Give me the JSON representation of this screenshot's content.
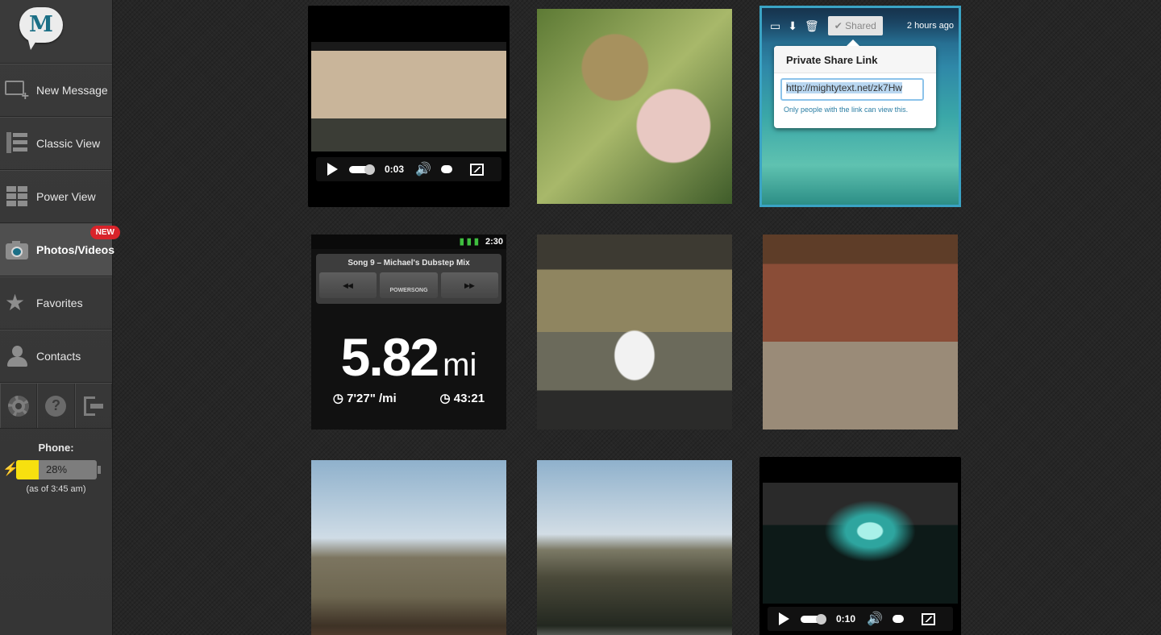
{
  "sidebar": {
    "logo_letter": "M",
    "items": [
      {
        "label": "New Message",
        "icon": "new-message-icon"
      },
      {
        "label": "Classic View",
        "icon": "classic-view-icon"
      },
      {
        "label": "Power View",
        "icon": "power-view-icon"
      },
      {
        "label": "Photos/Videos",
        "icon": "camera-icon",
        "active": true,
        "badge": "NEW"
      },
      {
        "label": "Favorites",
        "icon": "star-icon"
      },
      {
        "label": "Contacts",
        "icon": "contact-icon"
      }
    ],
    "tools": [
      {
        "icon": "settings-gear-icon"
      },
      {
        "icon": "help-icon",
        "glyph": "?"
      },
      {
        "icon": "logout-icon"
      }
    ],
    "phone": {
      "label": "Phone:",
      "battery_percent": 28,
      "battery_text": "28%",
      "as_of": "(as of 3:45 am)"
    },
    "accent_color": "#d8232a"
  },
  "gallery": {
    "videos": [
      {
        "time": "0:03"
      },
      {
        "time": "0:10"
      }
    ],
    "share": {
      "shared_label": "Shared",
      "check": "✔",
      "time_ago": "2 hours ago",
      "title": "Private Share Link",
      "link": "http://mightytext.net/zk7Hw",
      "note": "Only people with the link can view this.",
      "highlight_color": "#3aa3c4"
    },
    "run_screen": {
      "clock": "2:30",
      "song": "Song 9 – Michael's Dubstep Mix",
      "prev": "◂◂",
      "powersong": "POWERSONG",
      "next": "▸▸",
      "distance": "5.82",
      "unit": "mi",
      "pace": "◷ 7'27\" /mi",
      "duration": "◷ 43:21"
    }
  }
}
